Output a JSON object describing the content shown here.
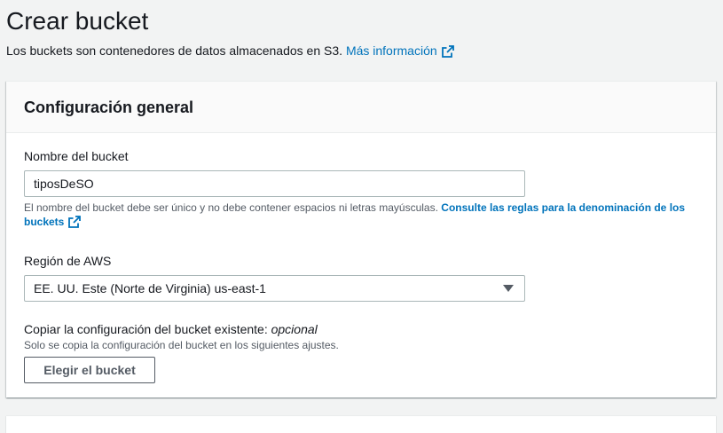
{
  "page": {
    "title": "Crear bucket",
    "description": "Los buckets son contenedores de datos almacenados en S3.",
    "more_info_link": "Más información"
  },
  "general_config": {
    "title": "Configuración general",
    "bucket_name": {
      "label": "Nombre del bucket",
      "value": "tiposDeSO",
      "hint": "El nombre del bucket debe ser único y no debe contener espacios ni letras mayúsculas.",
      "hint_link": "Consulte las reglas para la denominación de los buckets"
    },
    "region": {
      "label": "Región de AWS",
      "selected": "EE. UU. Este (Norte de Virginia) us-east-1"
    },
    "copy_settings": {
      "label": "Copiar la configuración del bucket existente:",
      "optional": "opcional",
      "description": "Solo se copia la configuración del bucket en los siguientes ajustes.",
      "button_label": "Elegir el bucket"
    }
  },
  "colors": {
    "link": "#0073bb",
    "background": "#f2f3f3",
    "panel": "#ffffff"
  },
  "icons": {
    "external_link": "external-link-icon",
    "dropdown": "caret-down-icon"
  }
}
